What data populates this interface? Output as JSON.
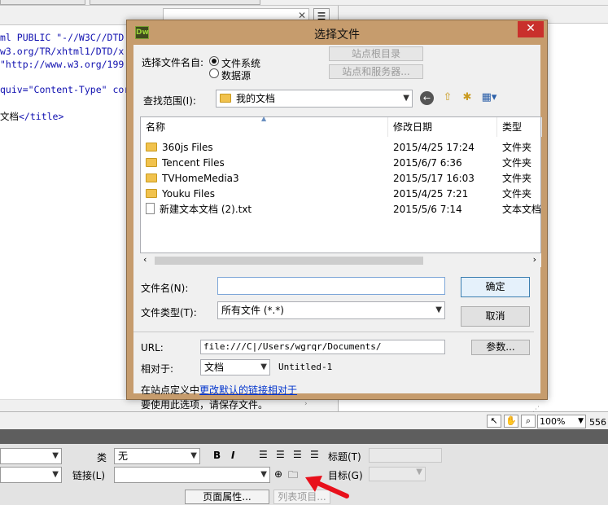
{
  "editor": {
    "code_lines": [
      "ml PUBLIC \"-//W3C//DTD",
      "w3.org/TR/xhtml1/DTD/x",
      "\"http://www.w3.org/199",
      "",
      "quiv=\"Content-Type\" cor",
      "",
      "文档</title>"
    ]
  },
  "status": {
    "zoom": "100%",
    "width": "556"
  },
  "props": {
    "class_label": "类",
    "class_value": "无",
    "link_label": "链接(L)",
    "title_label": "标题(T)",
    "target_label": "目标(G)",
    "bold": "B",
    "italic": "I",
    "page_props_button": "页面属性...",
    "list_item_button": "列表项目..."
  },
  "dialog": {
    "title": "选择文件",
    "logo": "Dw",
    "close_icon": "close-icon",
    "select_from_label": "选择文件名自:",
    "radio_filesystem": "文件系统",
    "radio_datasource": "数据源",
    "site_root_button": "站点根目录",
    "sites_servers_button": "站点和服务器...",
    "lookin_label": "查找范围(I):",
    "lookin_value": "我的文档",
    "columns": [
      "名称",
      "修改日期",
      "类型"
    ],
    "files": [
      {
        "name": "360js Files",
        "date": "2015/4/25 17:24",
        "type": "文件夹",
        "icon": "folder-icon"
      },
      {
        "name": "Tencent Files",
        "date": "2015/6/7 6:36",
        "type": "文件夹",
        "icon": "folder-icon"
      },
      {
        "name": "TVHomeMedia3",
        "date": "2015/5/17 16:03",
        "type": "文件夹",
        "icon": "folder-icon"
      },
      {
        "name": "Youku Files",
        "date": "2015/4/25 7:21",
        "type": "文件夹",
        "icon": "folder-icon"
      },
      {
        "name": "新建文本文档 (2).txt",
        "date": "2015/5/6 7:14",
        "type": "文本文档",
        "icon": "file-icon"
      }
    ],
    "filename_label": "文件名(N):",
    "filename_value": "",
    "filetype_label": "文件类型(T):",
    "filetype_value": "所有文件 (*.*)",
    "ok_button": "确定",
    "cancel_button": "取消",
    "url_label": "URL:",
    "url_value": "file:///C|/Users/wgrqr/Documents/",
    "params_button": "参数...",
    "relative_label": "相对于:",
    "relative_value": "文档",
    "relative_file": "Untitled-1",
    "note_prefix": "在站点定义中",
    "note_link": "更改默认的链接相对于",
    "note_line2": "要使用此选项，请保存文件。"
  },
  "colors": {
    "dialog_frame": "#c69c6d",
    "close_button": "#c9302c",
    "link": "#0033cc",
    "arrow": "#e8101b"
  }
}
